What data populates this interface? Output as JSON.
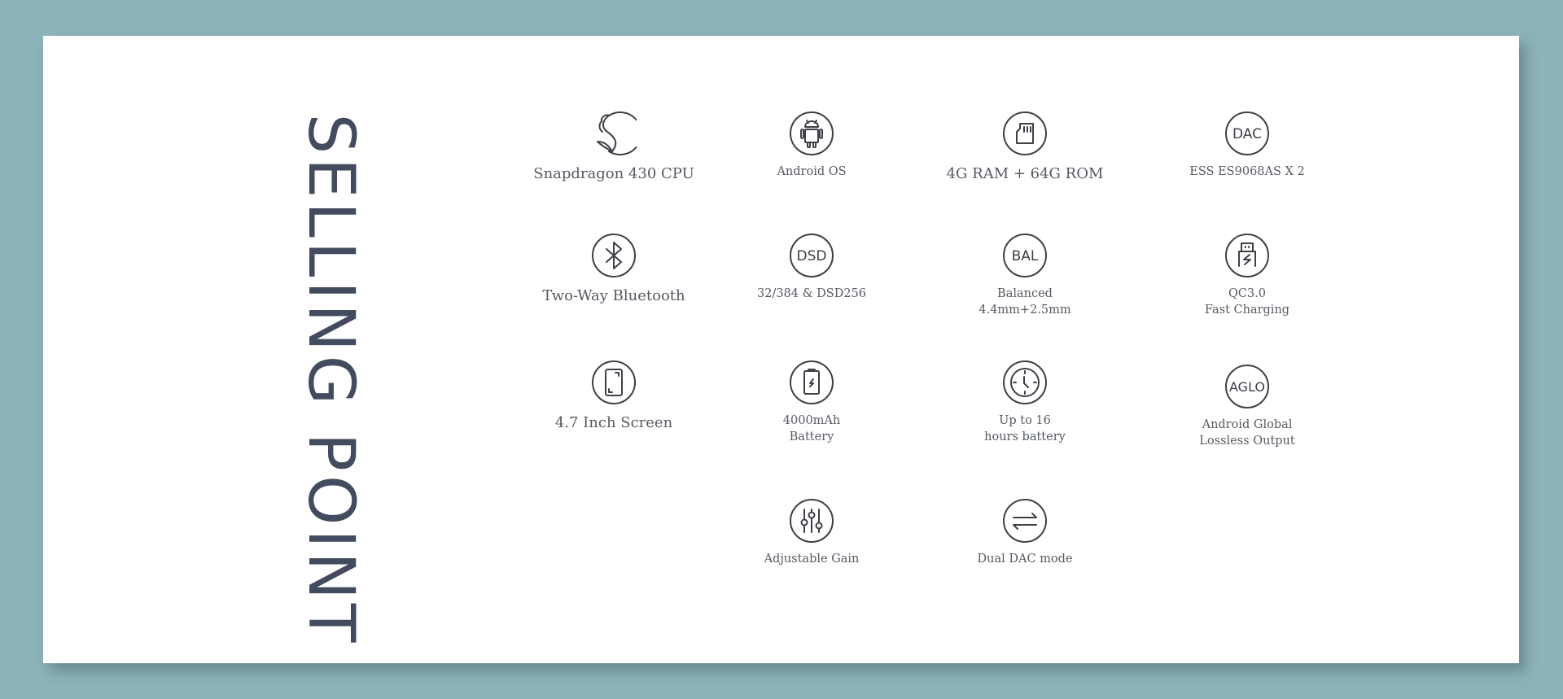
{
  "title": "SELLING POINT",
  "colors": {
    "background": "#8db3ba",
    "card": "#ffffff",
    "title": "#434c5e",
    "icon_stroke": "#3c4048",
    "label": "#555a63"
  },
  "features": [
    {
      "id": "snapdragon",
      "icon": "snapdragon-icon",
      "lines": [
        "Snapdragon  430 CPU"
      ]
    },
    {
      "id": "android",
      "icon": "android-icon",
      "lines": [
        "Android OS"
      ]
    },
    {
      "id": "memory",
      "icon": "sd-card-icon",
      "lines": [
        "4G RAM + 64G ROM"
      ]
    },
    {
      "id": "dac",
      "icon": "dac-icon",
      "icon_text": "DAC",
      "lines": [
        "ESS ES9068AS X 2"
      ]
    },
    {
      "id": "bluetooth",
      "icon": "bluetooth-icon",
      "lines": [
        "Two-Way  Bluetooth"
      ]
    },
    {
      "id": "dsd",
      "icon": "dsd-icon",
      "icon_text": "DSD",
      "lines": [
        "32/384 & DSD256"
      ]
    },
    {
      "id": "balanced",
      "icon": "bal-icon",
      "icon_text": "BAL",
      "lines": [
        "Balanced",
        "4.4mm+2.5mm"
      ]
    },
    {
      "id": "qc",
      "icon": "usb-charging-icon",
      "lines": [
        "QC3.0",
        "Fast Charging"
      ]
    },
    {
      "id": "screen",
      "icon": "phone-screen-icon",
      "lines": [
        "4.7  Inch Screen"
      ]
    },
    {
      "id": "battery",
      "icon": "battery-icon",
      "lines": [
        "4000mAh",
        "Battery"
      ]
    },
    {
      "id": "hours",
      "icon": "clock-icon",
      "lines": [
        "Up to 16",
        "hours battery"
      ]
    },
    {
      "id": "aglo",
      "icon": "aglo-icon",
      "icon_text": "AGLO",
      "lines": [
        "Android Global",
        "Lossless Output"
      ]
    },
    {
      "id": "gain",
      "icon": "sliders-icon",
      "lines": [
        "Adjustable Gain"
      ]
    },
    {
      "id": "dual-dac",
      "icon": "swap-arrows-icon",
      "lines": [
        "Dual DAC mode"
      ]
    }
  ]
}
